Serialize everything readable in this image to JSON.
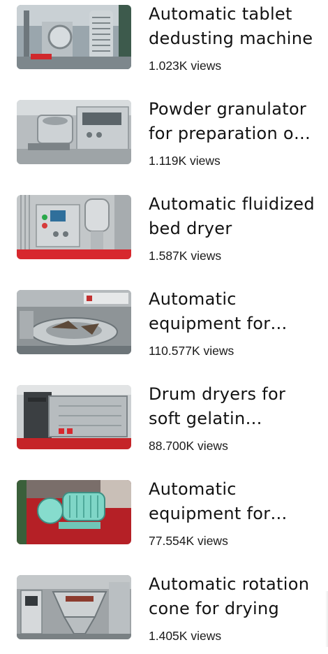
{
  "videos": [
    {
      "title": "Automatic tablet dedusting machine",
      "views": "1.023K views"
    },
    {
      "title": "Powder granulator for preparation of granules",
      "views": "1.119K views"
    },
    {
      "title": "Automatic fluidized bed dryer",
      "views": "1.587K views"
    },
    {
      "title": "Automatic equipment for capsule filling",
      "views": "110.577K views"
    },
    {
      "title": "Drum dryers for soft gelatin capsules",
      "views": "88.700K views"
    },
    {
      "title": "Automatic equipment for powder mixing",
      "views": "77.554K views"
    },
    {
      "title": "Automatic rotation cone for drying",
      "views": "1.405K views"
    }
  ]
}
